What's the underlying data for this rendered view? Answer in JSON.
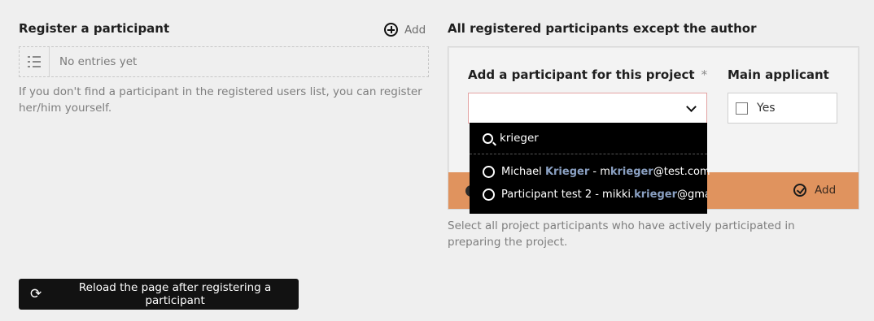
{
  "register": {
    "heading": "Register a participant",
    "add_label": "Add",
    "empty_text": "No entries yet",
    "help_text": "If you don't find a participant in the registered users list, you can register her/him yourself."
  },
  "reload_button": {
    "label": "Reload the page after registering a participant"
  },
  "participants": {
    "heading": "All registered participants except the author",
    "field_label": "Add a participant for this project",
    "required_mark": "*",
    "main_applicant_label": "Main applicant",
    "main_applicant_option": "Yes",
    "footer_add_label": "Add",
    "help_text": "Select all project participants who have actively participated in preparing the project."
  },
  "dropdown": {
    "search_value": "krieger",
    "options": [
      {
        "before": "Michael ",
        "match1": "Krieger",
        "middle": " - m",
        "match2": "krieger",
        "after": "@test.com"
      },
      {
        "before": "Participant test 2 - mikki.",
        "match1": "krieger",
        "middle": "@gmail.c",
        "match2": "",
        "after": ""
      }
    ]
  },
  "colors": {
    "background": "#efefef",
    "footer_accent": "#e0935e",
    "dropdown_bg": "#000000",
    "match_highlight": "#8aa0c2"
  },
  "icons": [
    "add-circle-icon",
    "list-icon",
    "chevron-down-icon",
    "search-icon",
    "radio-icon",
    "check-circle-icon",
    "reload-icon"
  ]
}
